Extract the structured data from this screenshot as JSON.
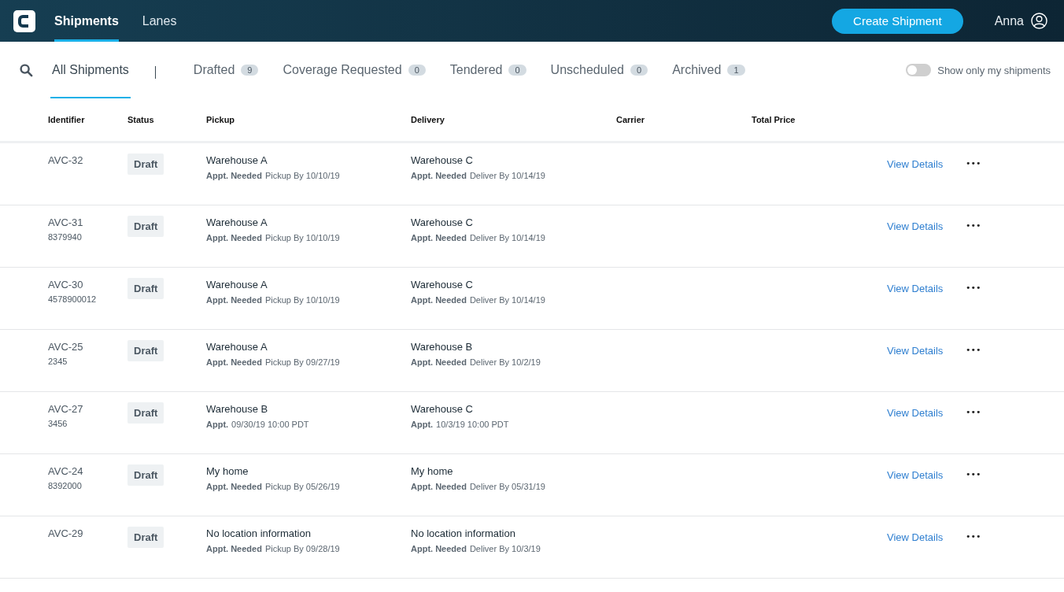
{
  "nav": {
    "items": [
      {
        "label": "Shipments",
        "selected": true
      },
      {
        "label": "Lanes",
        "selected": false
      }
    ],
    "create_button": "Create Shipment",
    "user": "Anna"
  },
  "filters": {
    "tabs": [
      {
        "label": "All Shipments",
        "selected": true
      },
      {
        "label": "Drafted",
        "count": "9",
        "selected": false
      },
      {
        "label": "Coverage Requested",
        "count": "0",
        "selected": false
      },
      {
        "label": "Tendered",
        "count": "0",
        "selected": false
      },
      {
        "label": "Unscheduled",
        "count": "0",
        "selected": false
      },
      {
        "label": "Archived",
        "count": "1",
        "selected": false
      }
    ],
    "toggle": {
      "label": "Show only my shipments",
      "on": false
    }
  },
  "table": {
    "columns": [
      "Identifier",
      "Status",
      "Pickup",
      "Delivery",
      "Carrier",
      "Total Price"
    ],
    "rows": [
      {
        "id": "AVC-32",
        "status": "Draft",
        "pickup": {
          "place": "Warehouse A",
          "label": "Appt. Needed",
          "detail": "Pickup By 10/10/19"
        },
        "delivery": {
          "place": "Warehouse C",
          "label": "Appt. Needed",
          "detail": "Deliver By 10/14/19"
        },
        "link": "View Details",
        "more": "•••"
      },
      {
        "id": "AVC-31",
        "ref": "8379940",
        "status": "Draft",
        "pickup": {
          "place": "Warehouse A",
          "label": "Appt. Needed",
          "detail": "Pickup By 10/10/19"
        },
        "delivery": {
          "place": "Warehouse C",
          "label": "Appt. Needed",
          "detail": "Deliver By 10/14/19"
        },
        "link": "View Details",
        "more": "•••"
      },
      {
        "id": "AVC-30",
        "ref": "4578900012",
        "status": "Draft",
        "pickup": {
          "place": "Warehouse A",
          "label": "Appt. Needed",
          "detail": "Pickup By 10/10/19"
        },
        "delivery": {
          "place": "Warehouse C",
          "label": "Appt. Needed",
          "detail": "Deliver By 10/14/19"
        },
        "link": "View Details",
        "more": "•••"
      },
      {
        "id": "AVC-25",
        "ref": "2345",
        "status": "Draft",
        "pickup": {
          "place": "Warehouse A",
          "label": "Appt. Needed",
          "detail": "Pickup By 09/27/19"
        },
        "delivery": {
          "place": "Warehouse B",
          "label": "Appt. Needed",
          "detail": "Deliver By 10/2/19"
        },
        "link": "View Details",
        "more": "•••"
      },
      {
        "id": "AVC-27",
        "ref": "3456",
        "status": "Draft",
        "pickup": {
          "place": "Warehouse B",
          "label": "Appt.",
          "detail": "09/30/19 10:00 PDT"
        },
        "delivery": {
          "place": "Warehouse C",
          "label": "Appt.",
          "detail": "10/3/19 10:00 PDT"
        },
        "link": "View Details",
        "more": "•••"
      },
      {
        "id": "AVC-24",
        "ref": "8392000",
        "status": "Draft",
        "pickup": {
          "place": "My home",
          "label": "Appt. Needed",
          "detail": "Pickup By 05/26/19"
        },
        "delivery": {
          "place": "My home",
          "label": "Appt. Needed",
          "detail": "Deliver By 05/31/19"
        },
        "link": "View Details",
        "more": "•••"
      },
      {
        "id": "AVC-29",
        "status": "Draft",
        "pickup": {
          "place": "No location information",
          "label": "Appt. Needed",
          "detail": "Pickup By 09/28/19"
        },
        "delivery": {
          "place": "No location information",
          "label": "Appt. Needed",
          "detail": "Deliver By 10/3/19"
        },
        "link": "View Details",
        "more": "•••"
      }
    ]
  }
}
